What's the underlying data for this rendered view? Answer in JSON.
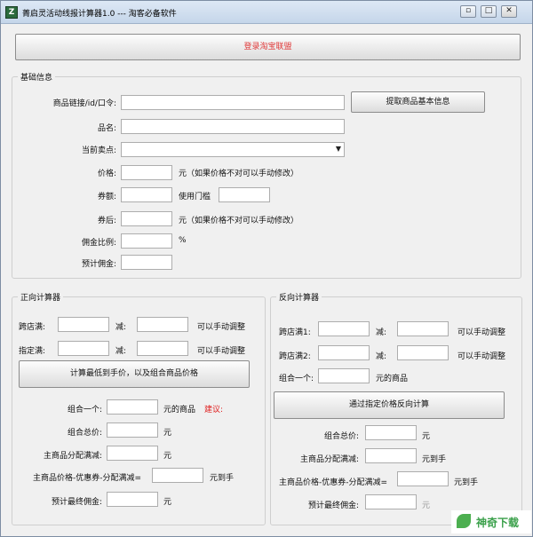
{
  "window": {
    "title": "菁启灵活动线报计算器1.0   ---   淘客必备软件",
    "app_icon_glyph": "Z",
    "controls": {
      "minimize": "▫",
      "maximize": "□",
      "close": "✕"
    }
  },
  "login_button": "登录淘宝联盟",
  "basic": {
    "title": "基础信息",
    "link_label": "商品链接/id/口令:",
    "fetch_button": "提取商品基本信息",
    "name_label": "品名:",
    "selling_point_label": "当前卖点:",
    "price_label": "价格:",
    "price_unit_hint": "元（如果价格不对可以手动修改）",
    "coupon_label": "券额:",
    "threshold_label": "使用门槛",
    "after_coupon_label": "券后:",
    "after_coupon_hint": "元（如果价格不对可以手动修改）",
    "commission_rate_label": "佣金比例:",
    "commission_rate_unit": "%",
    "est_commission_label": "预计佣金:"
  },
  "forward": {
    "title": "正向计算器",
    "cross_store_label": "跨店满:",
    "minus_label": "减:",
    "manual_adjust": "可以手动调整",
    "designated_label": "指定满:",
    "minus_label2": "减:",
    "manual_adjust2": "可以手动调整",
    "calc_button": "计算最低到手价，以及组合商品价格",
    "combo_label": "组合一个:",
    "combo_unit": "元的商品",
    "suggest": "建议:",
    "combo_total_label": "组合总价:",
    "combo_total_unit": "元",
    "main_alloc_label": "主商品分配满减:",
    "main_alloc_unit": "元",
    "final_formula_label": "主商品价格-优惠券-分配满减=",
    "final_formula_unit": "元到手",
    "est_final_label": "预计最终佣金:",
    "est_final_unit": "元"
  },
  "reverse": {
    "title": "反向计算器",
    "cross1_label": "跨店满1:",
    "minus1_label": "减:",
    "manual1": "可以手动调整",
    "cross2_label": "跨店满2:",
    "minus2_label": "减:",
    "manual2": "可以手动调整",
    "combo_label": "组合一个:",
    "combo_unit": "元的商品",
    "reverse_button": "通过指定价格反向计算",
    "combo_total_label": "组合总价:",
    "combo_total_unit": "元",
    "main_alloc_label": "主商品分配满减:",
    "main_alloc_unit": "元到手",
    "final_formula_label": "主商品价格-优惠券-分配满减=",
    "final_formula_unit": "元到手",
    "est_final_label": "预计最终佣金:",
    "est_final_unit": "元"
  },
  "watermark": "神奇下载"
}
